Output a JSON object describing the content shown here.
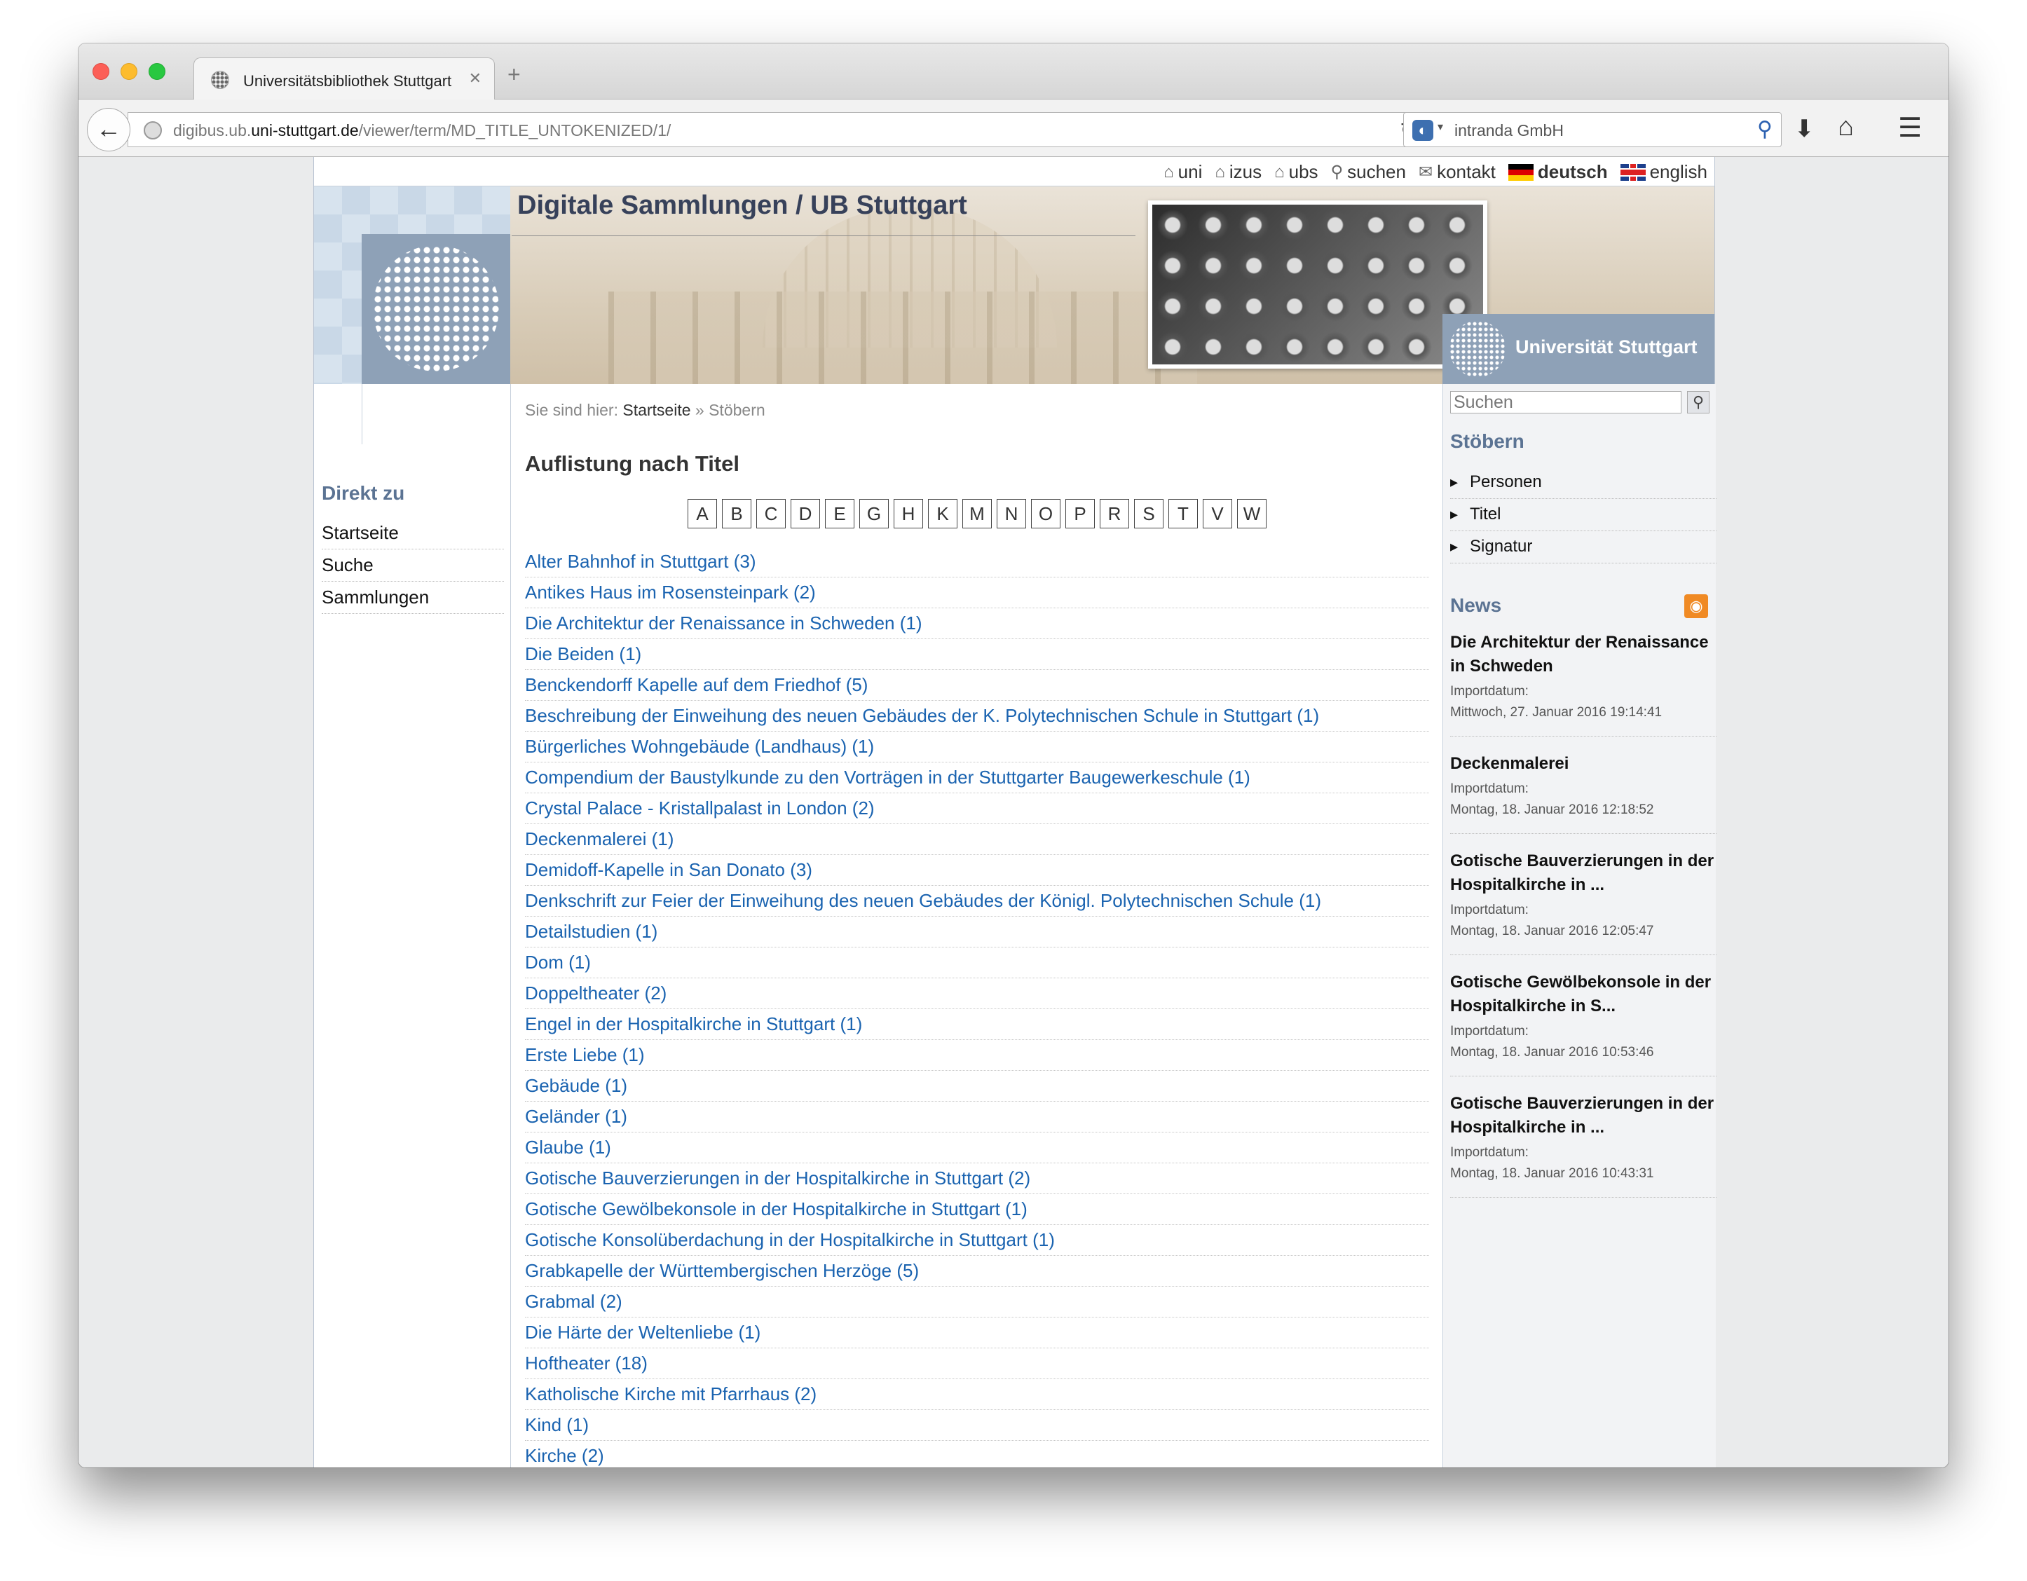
{
  "browser": {
    "tab_title": "Universitätsbibliothek Stuttgart",
    "url_prefix": "digibus.ub.",
    "url_domain": "uni-stuttgart.de",
    "url_path": "/viewer/term/MD_TITLE_UNTOKENIZED/1/",
    "search_engine": "intranda GmbH"
  },
  "topnav": {
    "items": [
      "uni",
      "izus",
      "ubs",
      "suchen",
      "kontakt"
    ],
    "lang_de": "deutsch",
    "lang_en": "english"
  },
  "header": {
    "site_title": "Digitale Sammlungen / UB Stuttgart",
    "uni_name": "Universität Stuttgart"
  },
  "left": {
    "heading": "Direkt zu",
    "items": [
      "Startseite",
      "Suche",
      "Sammlungen"
    ]
  },
  "main": {
    "breadcrumb_prefix": "Sie sind hier:",
    "breadcrumb_home": "Startseite",
    "breadcrumb_current": "» Stöbern",
    "heading": "Auflistung nach Titel",
    "letters": [
      "A",
      "B",
      "C",
      "D",
      "E",
      "G",
      "H",
      "K",
      "M",
      "N",
      "O",
      "P",
      "R",
      "S",
      "T",
      "V",
      "W"
    ],
    "titles": [
      "Alter Bahnhof in Stuttgart (3)",
      "Antikes Haus im Rosensteinpark (2)",
      "Die Architektur der Renaissance in Schweden (1)",
      "Die Beiden (1)",
      "Benckendorff Kapelle auf dem Friedhof (5)",
      "Beschreibung der Einweihung des neuen Gebäudes der K. Polytechnischen Schule in Stuttgart (1)",
      "Bürgerliches Wohngebäude (Landhaus) (1)",
      "Compendium der Baustylkunde zu den Vorträgen in der Stuttgarter Baugewerkeschule (1)",
      "Crystal Palace - Kristallpalast in London (2)",
      "Deckenmalerei (1)",
      "Demidoff-Kapelle in San Donato (3)",
      "Denkschrift zur Feier der Einweihung des neuen Gebäudes der Königl. Polytechnischen Schule (1)",
      "Detailstudien (1)",
      "Dom (1)",
      "Doppeltheater (2)",
      "Engel in der Hospitalkirche in Stuttgart (1)",
      "Erste Liebe (1)",
      "Gebäude (1)",
      "Geländer (1)",
      "Glaube (1)",
      "Gotische Bauverzierungen in der Hospitalkirche in Stuttgart (2)",
      "Gotische Gewölbekonsole in der Hospitalkirche in Stuttgart (1)",
      "Gotische Konsolüberdachung in der Hospitalkirche in Stuttgart (1)",
      "Grabkapelle der Württembergischen Herzöge (5)",
      "Grabmal (2)",
      "Die Härte der Weltenliebe (1)",
      "Hoftheater (18)",
      "Katholische Kirche mit Pfarrhaus (2)",
      "Kind (1)",
      "Kirche (2)"
    ]
  },
  "right": {
    "search_placeholder": "Suchen",
    "browse_heading": "Stöbern",
    "browse_items": [
      "Personen",
      "Titel",
      "Signatur"
    ],
    "news_heading": "News",
    "news": [
      {
        "title": "Die Architektur der Renaissance in Schweden",
        "label": "Importdatum:",
        "date": "Mittwoch, 27. Januar 2016 19:14:41"
      },
      {
        "title": "Deckenmalerei",
        "label": "Importdatum:",
        "date": "Montag, 18. Januar 2016 12:18:52"
      },
      {
        "title": "Gotische Bauverzierungen in der Hospitalkirche in ...",
        "label": "Importdatum:",
        "date": "Montag, 18. Januar 2016 12:05:47"
      },
      {
        "title": "Gotische Gewölbekonsole in der Hospitalkirche in S...",
        "label": "Importdatum:",
        "date": "Montag, 18. Januar 2016 10:53:46"
      },
      {
        "title": "Gotische Bauverzierungen in der Hospitalkirche in ...",
        "label": "Importdatum:",
        "date": "Montag, 18. Januar 2016 10:43:31"
      }
    ]
  }
}
